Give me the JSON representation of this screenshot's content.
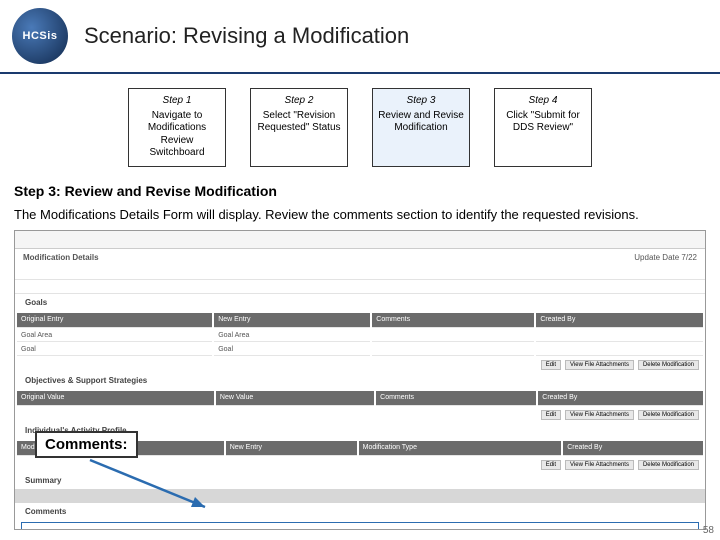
{
  "header": {
    "logo_text": "HCSis",
    "title": "Scenario: Revising a Modification"
  },
  "steps": [
    {
      "label": "Step 1",
      "desc": "Navigate to Modifications Review Switchboard"
    },
    {
      "label": "Step 2",
      "desc": "Select \"Revision Requested\" Status"
    },
    {
      "label": "Step 3",
      "desc": "Review and Revise Modification",
      "active": true
    },
    {
      "label": "Step 4",
      "desc": "Click \"Submit for DDS Review\""
    }
  ],
  "section": {
    "title": "Step 3: Review and Revise Modification",
    "desc": "The Modifications Details Form will display. Review the comments section to identify the requested revisions."
  },
  "mock": {
    "region_title": "Modification Details",
    "update_date": "Update Date 7/22",
    "goals_header": "Goals",
    "tables": [
      {
        "cols": [
          "Original Entry",
          "New Entry",
          "Comments",
          "Created By"
        ]
      },
      {
        "cols": [
          "Original Value",
          "New Value",
          "Comments",
          "Created By"
        ]
      },
      {
        "cols": [
          "Modification Entry",
          "New Entry",
          "Modification Type",
          "Created By"
        ]
      }
    ],
    "objectives_header": "Objectives & Support Strategies",
    "activities_header": "Individual's Activity Profile",
    "summary_header": "Summary",
    "comments_header": "Comments",
    "buttons": [
      "Edit",
      "View File Attachments",
      "Delete Modification"
    ]
  },
  "callout": "Comments:",
  "page_number": "58"
}
